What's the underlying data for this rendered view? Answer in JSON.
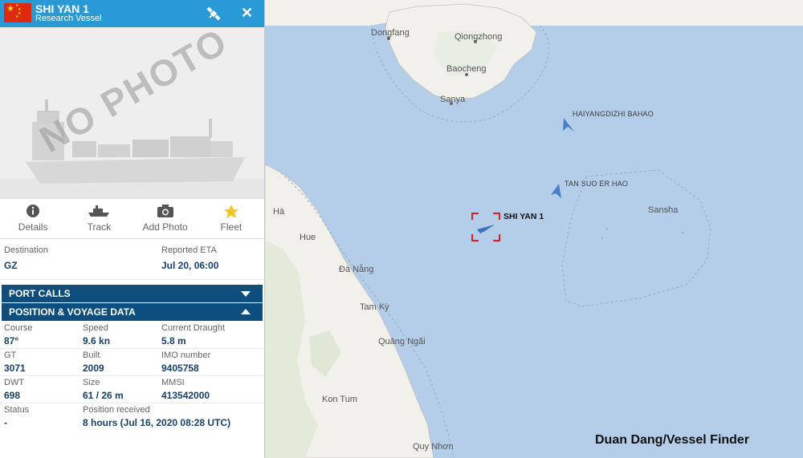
{
  "vessel": {
    "name": "SHI YAN 1",
    "type": "Research Vessel",
    "flag": "china-flag-icon",
    "photo_placeholder": "NO PHOTO"
  },
  "actions": [
    {
      "label": "Details",
      "icon": "info-icon"
    },
    {
      "label": "Track",
      "icon": "ship-track-icon"
    },
    {
      "label": "Add Photo",
      "icon": "camera-icon"
    },
    {
      "label": "Fleet",
      "icon": "star-icon"
    }
  ],
  "destination": {
    "dest_label": "Destination",
    "dest_value": "GZ",
    "eta_label": "Reported ETA",
    "eta_value": "Jul 20, 06:00"
  },
  "sections": {
    "port_calls": "PORT CALLS",
    "position_voyage": "POSITION & VOYAGE DATA"
  },
  "voyage": {
    "course_label": "Course",
    "course": "87°",
    "speed_label": "Speed",
    "speed": "9.6 kn",
    "draught_label": "Current Draught",
    "draught": "5.8 m",
    "gt_label": "GT",
    "gt": "3071",
    "built_label": "Built",
    "built": "2009",
    "imo_label": "IMO number",
    "imo": "9405758",
    "dwt_label": "DWT",
    "dwt": "698",
    "size_label": "Size",
    "size": "61 / 26 m",
    "mmsi_label": "MMSI",
    "mmsi": "413542000",
    "status_label": "Status",
    "status": "-",
    "pos_label": "Position received",
    "pos": "8 hours (Jul 16, 2020 08:28 UTC)"
  },
  "map": {
    "places": [
      "Dongfang",
      "Qiongzhong",
      "Baocheng",
      "Sanya",
      "Sansha",
      "Hue",
      "Đà Nẵng",
      "Tam Kỳ",
      "Quảng Ngãi",
      "Kon Tum",
      "Quy Nhơn",
      "Hà"
    ],
    "other_vessels": [
      "HAIYANGDIZHI BAHAO",
      "TAN SUO ER HAO"
    ],
    "selected_vessel": "SHI YAN 1"
  },
  "credit": "Duan Dang/Vessel Finder",
  "colors": {
    "sea": "#b4cde9",
    "land": "#f2f0eb",
    "header": "#2a9ad6",
    "section": "#0e4e7e",
    "value_text": "#17406d"
  }
}
